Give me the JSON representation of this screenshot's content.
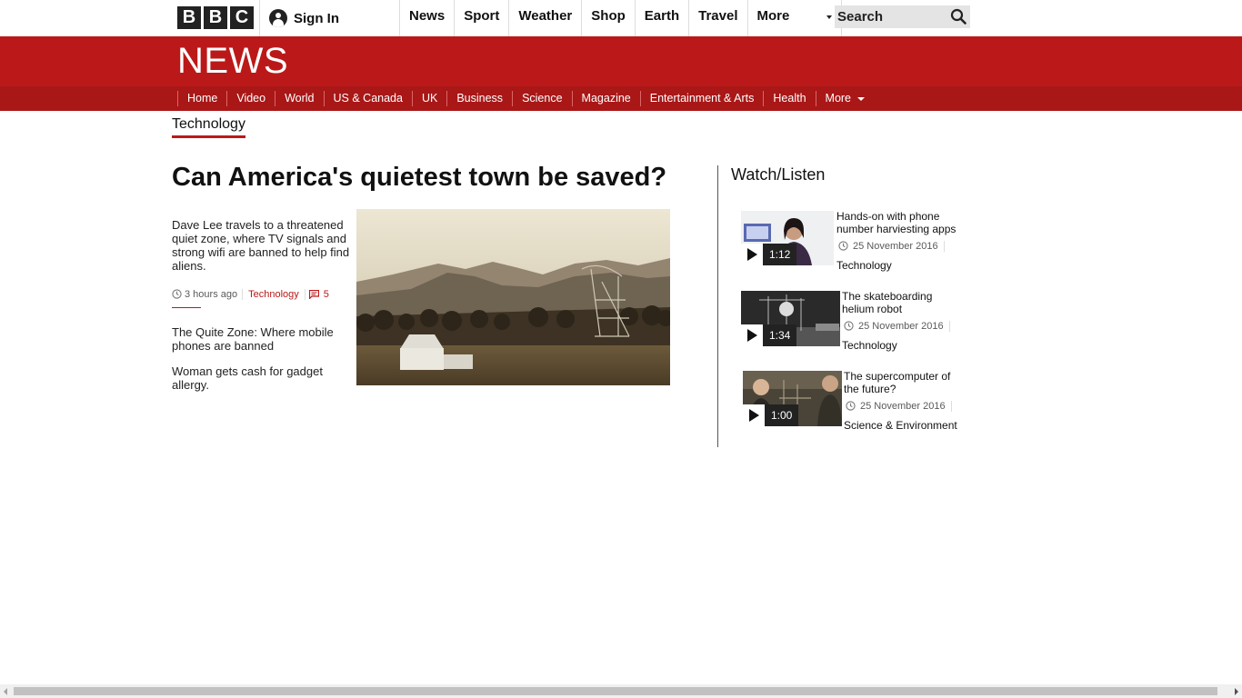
{
  "brand": {
    "logo_letters": [
      "B",
      "B",
      "C"
    ],
    "accent_color": "#bb1919"
  },
  "topbar": {
    "signin_label": "Sign In",
    "nav": [
      "News",
      "Sport",
      "Weather",
      "Shop",
      "Earth",
      "Travel",
      "More"
    ],
    "search_placeholder": "Search"
  },
  "banner": {
    "title": "NEWS"
  },
  "section_nav": {
    "items": [
      "Home",
      "Video",
      "World",
      "US & Canada",
      "UK",
      "Business",
      "Science",
      "Magazine",
      "Entertainment & Arts",
      "Health",
      "More"
    ]
  },
  "page": {
    "section_label": "Technology"
  },
  "story": {
    "headline": "Can America's quietest town be saved?",
    "summary": "Dave Lee travels to a threatened quiet zone, where TV signals and strong wifi are banned to help find aliens.",
    "time": "3 hours ago",
    "section": "Technology",
    "comment_count": "5",
    "related": [
      "The Quite Zone: Where mobile phones are banned",
      "Woman gets cash for gadget allergy."
    ]
  },
  "watch_listen": {
    "title": "Watch/Listen",
    "items": [
      {
        "headline": "Hands-on with phone number harviesting apps",
        "duration": "1:12",
        "date": "25 November 2016",
        "section": "Technology"
      },
      {
        "headline": "The skateboarding helium robot",
        "duration": "1:34",
        "date": "25 November 2016",
        "section": "Technology"
      },
      {
        "headline": "The supercomputer of the future?",
        "duration": "1:00",
        "date": "25 November 2016",
        "section": "Science & Environment"
      }
    ]
  }
}
